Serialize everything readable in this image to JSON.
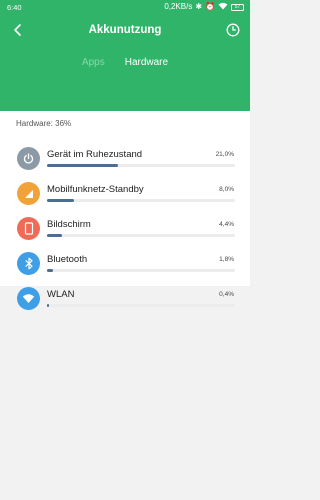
{
  "status_bar": {
    "time": "6:40",
    "speed": "0,2KB/s",
    "battery": "57"
  },
  "header": {
    "title": "Akkunutzung",
    "back_icon": "back-arrow-icon",
    "history_icon": "clock-icon",
    "tabs": [
      {
        "label": "Apps",
        "active": false
      },
      {
        "label": "Hardware",
        "active": true
      }
    ]
  },
  "summary": "Hardware: 36%",
  "items": [
    {
      "label": "Gerät im Ruhezustand",
      "percent_text": "21,0%",
      "percent": 21.0,
      "icon": "power-icon",
      "color": "#8b9aa6"
    },
    {
      "label": "Mobilfunknetz-Standby",
      "percent_text": "8,0%",
      "percent": 8.0,
      "icon": "signal-icon",
      "color": "#f1a33a"
    },
    {
      "label": "Bildschirm",
      "percent_text": "4,4%",
      "percent": 4.4,
      "icon": "phone-screen-icon",
      "color": "#ee6b57"
    },
    {
      "label": "Bluetooth",
      "percent_text": "1,8%",
      "percent": 1.8,
      "icon": "bluetooth-icon",
      "color": "#3e9ee6"
    },
    {
      "label": "WLAN",
      "percent_text": "0,4%",
      "percent": 0.4,
      "icon": "wifi-icon",
      "color": "#3e9ee6"
    }
  ],
  "colors": {
    "brand_green": "#2fb46a",
    "progress_fill": "#4d6f8f",
    "track": "#ececec"
  }
}
